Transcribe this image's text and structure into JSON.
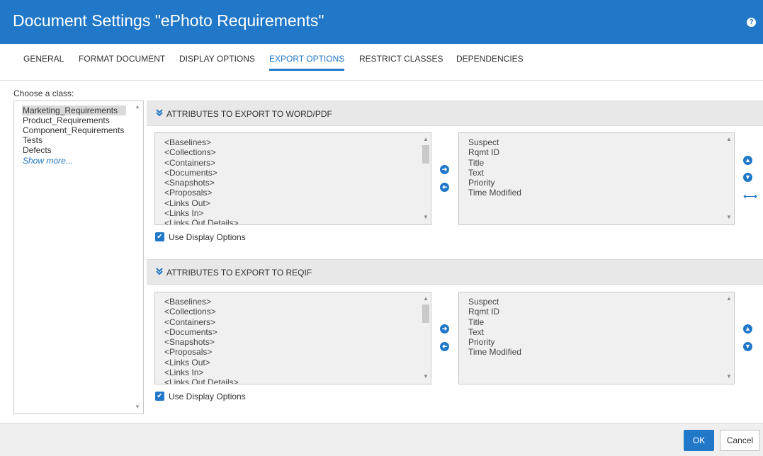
{
  "dialog": {
    "title": "Document Settings \"ePhoto Requirements\"",
    "help_icon": "?"
  },
  "tabs": [
    {
      "label": "GENERAL"
    },
    {
      "label": "FORMAT DOCUMENT"
    },
    {
      "label": "DISPLAY OPTIONS"
    },
    {
      "label": "EXPORT OPTIONS"
    },
    {
      "label": "RESTRICT CLASSES"
    },
    {
      "label": "DEPENDENCIES"
    }
  ],
  "class_chooser": {
    "label": "Choose a class:",
    "items": [
      "Marketing_Requirements",
      "Product_Requirements",
      "Component_Requirements",
      "Tests",
      "Defects"
    ],
    "selected": "Marketing_Requirements",
    "show_more": "Show more..."
  },
  "sections": [
    {
      "title": "ATTRIBUTES TO EXPORT TO WORD/PDF",
      "available": [
        "<Baselines>",
        "<Collections>",
        "<Containers>",
        "<Documents>",
        "<Snapshots>",
        "<Proposals>",
        "<Links Out>",
        "<Links In>",
        "<Links Out Details>"
      ],
      "selected": [
        "Suspect",
        "Rqmt ID",
        "Title",
        "Text",
        "Priority",
        "Time Modified"
      ],
      "checkbox_label": "Use Display Options",
      "checked": true
    },
    {
      "title": "ATTRIBUTES TO EXPORT TO REQIF",
      "available": [
        "<Baselines>",
        "<Collections>",
        "<Containers>",
        "<Documents>",
        "<Snapshots>",
        "<Proposals>",
        "<Links Out>",
        "<Links In>",
        "<Links Out Details>"
      ],
      "selected": [
        "Suspect",
        "Rqmt ID",
        "Title",
        "Text",
        "Priority",
        "Time Modified"
      ],
      "checkbox_label": "Use Display Options",
      "checked": true
    }
  ],
  "footer": {
    "ok_label": "OK",
    "cancel_label": "Cancel"
  },
  "colors": {
    "accent": "#2178c8",
    "header_bg": "#2178c8"
  }
}
